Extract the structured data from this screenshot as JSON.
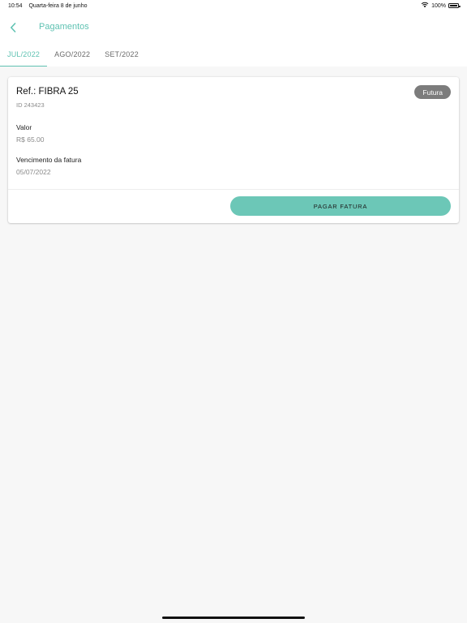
{
  "status_bar": {
    "time": "10:54",
    "date": "Quarta-feira 8 de junho",
    "battery": "100%",
    "icons": [
      "wifi-icon",
      "battery-icon"
    ]
  },
  "header": {
    "back_icon": "chevron-left-icon",
    "title": "Pagamentos",
    "accent_color": "#5fc2b2"
  },
  "tabs": [
    {
      "label": "JUL/2022",
      "active": true
    },
    {
      "label": "AGO/2022",
      "active": false
    },
    {
      "label": "SET/2022",
      "active": false
    }
  ],
  "invoice": {
    "ref": "Ref.: FIBRA 25",
    "id": "ID 243423",
    "status": "Futura",
    "amount_label": "Valor",
    "amount_value": "R$ 65.00",
    "due_label": "Vencimento da fatura",
    "due_value": "05/07/2022",
    "pay_button": "PAGAR FATURA",
    "button_color": "#6cc7b7",
    "badge_color": "#7c7c7c"
  }
}
